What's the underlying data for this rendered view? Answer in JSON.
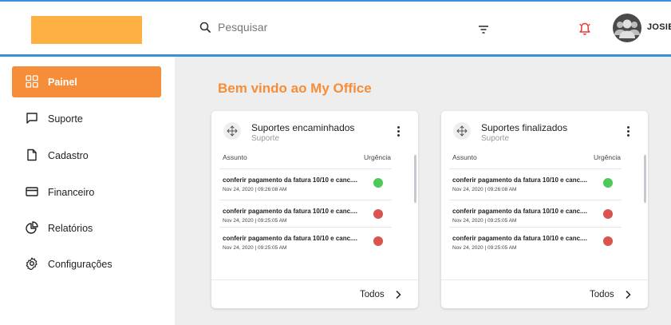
{
  "header": {
    "search_placeholder": "Pesquisar",
    "username": "JOSIE"
  },
  "colors": {
    "accent": "#f68d38",
    "header_line": "#3a8fdc",
    "logo": "#ffb042",
    "urgency_green": "#4cc95a",
    "urgency_red": "#d9534f"
  },
  "sidebar": {
    "items": [
      {
        "label": "Painel",
        "icon": "grid-icon",
        "active": true
      },
      {
        "label": "Suporte",
        "icon": "chat-icon"
      },
      {
        "label": "Cadastro",
        "icon": "document-icon"
      },
      {
        "label": "Financeiro",
        "icon": "credit-card-icon"
      },
      {
        "label": "Relatórios",
        "icon": "pie-chart-icon"
      },
      {
        "label": "Configurações",
        "icon": "gear-icon"
      }
    ]
  },
  "main": {
    "welcome": "Bem vindo ao My Office",
    "cards": [
      {
        "title": "Suportes encaminhados",
        "subtitle": "Suporte",
        "col_subject": "Assunto",
        "col_urgency": "Urgência",
        "rows": [
          {
            "title": "conferir pagamento da fatura 10/10 e canc....",
            "date": "Nov 24, 2020 | 09:26:08 AM",
            "urgency": "green"
          },
          {
            "title": "conferir pagamento da fatura 10/10 e canc....",
            "date": "Nov 24, 2020 | 09:25:05 AM",
            "urgency": "red"
          },
          {
            "title": "conferir pagamento da fatura 10/10 e canc....",
            "date": "Nov 24, 2020 | 09:25:05 AM",
            "urgency": "red"
          }
        ],
        "footer_link": "Todos"
      },
      {
        "title": "Suportes finalizados",
        "subtitle": "Suporte",
        "col_subject": "Assunto",
        "col_urgency": "Urgência",
        "rows": [
          {
            "title": "conferir pagamento da fatura 10/10 e canc....",
            "date": "Nov 24, 2020 | 09:26:08 AM",
            "urgency": "green"
          },
          {
            "title": "conferir pagamento da fatura 10/10 e canc....",
            "date": "Nov 24, 2020 | 09:25:05 AM",
            "urgency": "red"
          },
          {
            "title": "conferir pagamento da fatura 10/10 e canc....",
            "date": "Nov 24, 2020 | 09:25:05 AM",
            "urgency": "red"
          }
        ],
        "footer_link": "Todos"
      }
    ]
  }
}
